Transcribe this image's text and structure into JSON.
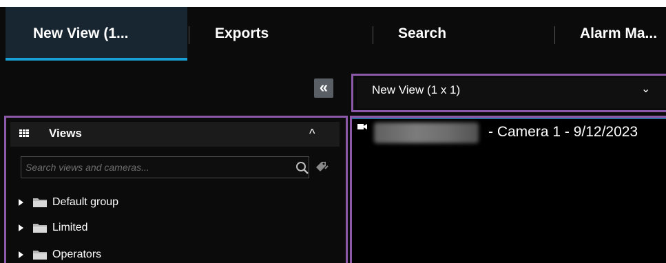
{
  "tabs": [
    {
      "label": "New View (1..."
    },
    {
      "label": "Exports"
    },
    {
      "label": "Search"
    },
    {
      "label": "Alarm Ma..."
    }
  ],
  "toolbar": {
    "collapse_glyph": "«",
    "view_select_value": "New View (1 x 1)",
    "view_select_chevron": "⌄"
  },
  "views_panel": {
    "title": "Views",
    "collapse_glyph": "^",
    "search_placeholder": "Search views and cameras...",
    "tree": [
      {
        "label": "Default group"
      },
      {
        "label": "Limited"
      },
      {
        "label": "Operators"
      }
    ]
  },
  "camera_view": {
    "title": "- Camera 1 - 9/12/2023"
  },
  "colors": {
    "accent": "#18a0d6",
    "highlight_border": "#8c59a8",
    "active_tab_bg": "#182632"
  },
  "icons": [
    "grid-icon",
    "search-icon",
    "tag-icon",
    "folder-icon",
    "camera-icon"
  ]
}
